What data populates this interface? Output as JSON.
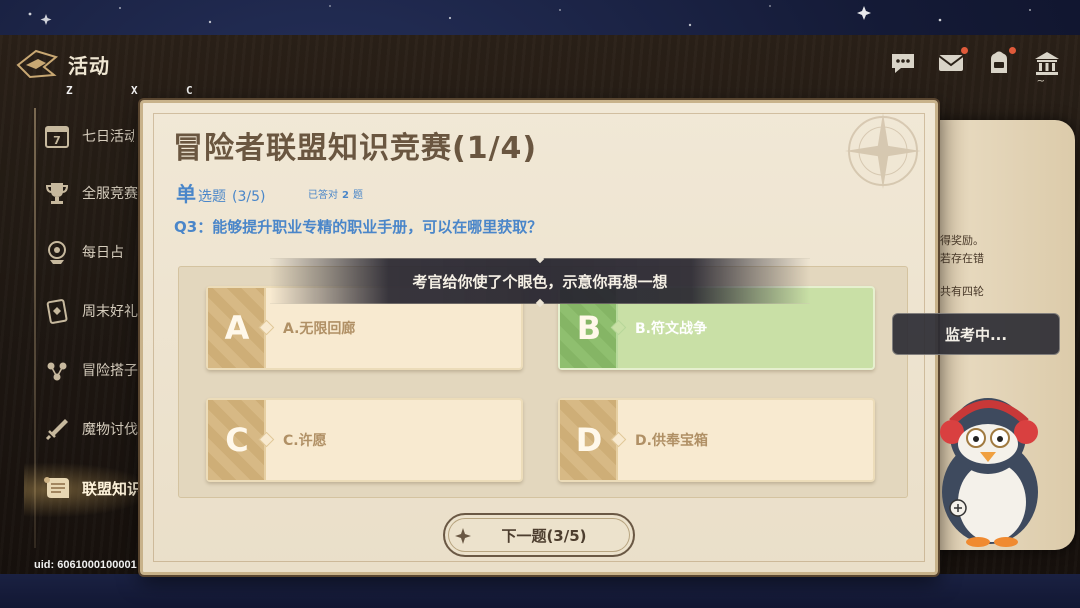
{
  "header": {
    "title": "活动",
    "key_hints": [
      "Z",
      "X",
      "C"
    ],
    "icons": [
      "chat-icon",
      "mail-icon",
      "backpack-icon",
      "bank-icon"
    ],
    "tilde": "~"
  },
  "sidebar": {
    "items": [
      {
        "label": "七日活动",
        "icon": "calendar-7-icon"
      },
      {
        "label": "全服竞赛",
        "icon": "trophy-icon"
      },
      {
        "label": "每日占卜",
        "icon": "fortune-icon"
      },
      {
        "label": "周末好礼",
        "icon": "gift-card-icon"
      },
      {
        "label": "冒险搭子",
        "icon": "partner-icon"
      },
      {
        "label": "魔物讨伐",
        "icon": "sword-icon"
      },
      {
        "label": "联盟知识",
        "icon": "scroll-icon",
        "active": true
      }
    ]
  },
  "quiz": {
    "title": "冒险者联盟知识竞赛(1/4)",
    "type_big": "单",
    "type_rest": "选题",
    "progress": "(3/5)",
    "correct_label": "已答对",
    "correct_count": "2",
    "correct_unit": "题",
    "question": "Q3：能够提升职业专精的职业手册，可以在哪里获取？",
    "options": [
      {
        "letter": "A",
        "text": "A.无限回廊",
        "state": "normal"
      },
      {
        "letter": "B",
        "text": "B.符文战争",
        "state": "correct"
      },
      {
        "letter": "C",
        "text": "C.许愿",
        "state": "normal"
      },
      {
        "letter": "D",
        "text": "D.供奉宝箱",
        "state": "normal"
      }
    ],
    "toast": "考官给你使了个眼色，示意你再想一想",
    "next_button": "下一题(3/5)"
  },
  "monitor": {
    "label": "监考中..."
  },
  "book": {
    "lines": [
      "得奖励。",
      "若存在错",
      "共有四轮"
    ]
  },
  "uid": "uid: 6061000100001",
  "colors": {
    "accent_blue": "#4a86c9",
    "correct_green": "#c9e0a6",
    "option_tan": "#f8ead0",
    "title_brown": "#6a5640"
  }
}
